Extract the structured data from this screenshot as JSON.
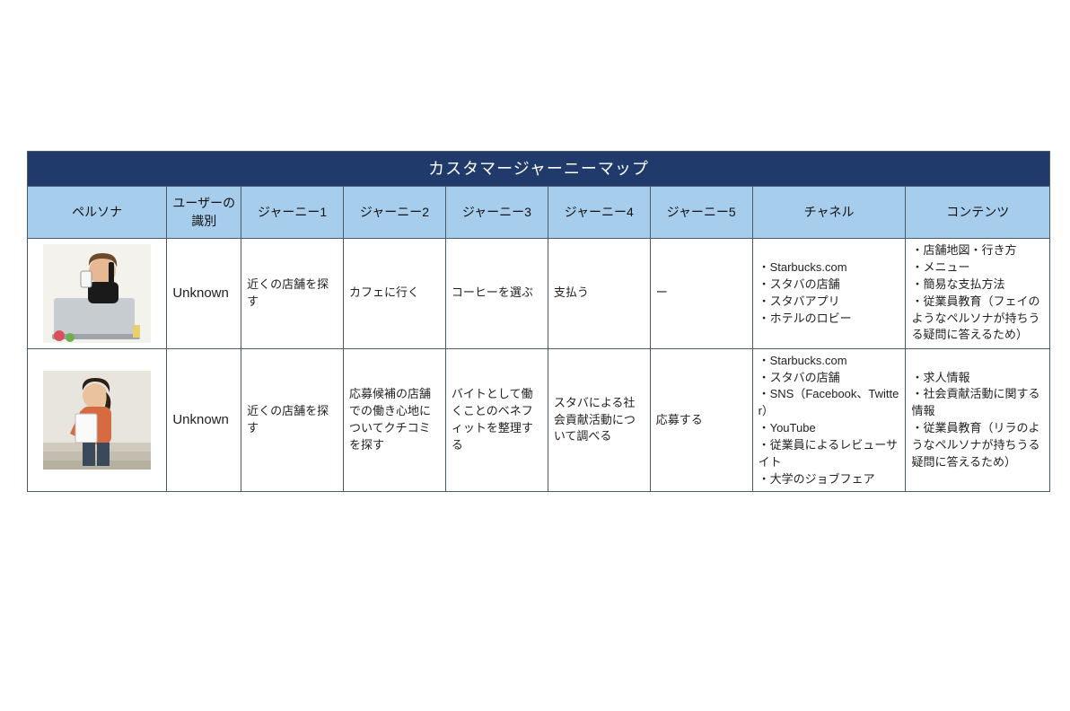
{
  "table": {
    "title": "カスタマージャーニーマップ",
    "headers": [
      "ペルソナ",
      "ユーザーの識別",
      "ジャーニー1",
      "ジャーニー2",
      "ジャーニー3",
      "ジャーニー4",
      "ジャーニー5",
      "チャネル",
      "コンテンツ"
    ],
    "rows": [
      {
        "persona_icon": "persona-woman-phone-laptop",
        "user_identity": "Unknown",
        "journey1": "近くの店舗を探す",
        "journey2": "カフェに行く",
        "journey3": "コーヒーを選ぶ",
        "journey4": "支払う",
        "journey5": "ー",
        "channel": "・Starbucks.com\n・スタバの店舗\n・スタバアプリ\n・ホテルのロビー",
        "contents": "・店舗地図・行き方\n・メニュー\n・簡易な支払方法\n・従業員教育（フェイのようなペルソナが持ちうる疑問に答えるため）"
      },
      {
        "persona_icon": "persona-student-steps",
        "user_identity": "Unknown",
        "journey1": "近くの店舗を探す",
        "journey2": "応募候補の店舗での働き心地についてクチコミを探す",
        "journey3": "バイトとして働くことのベネフィットを整理する",
        "journey4": "スタバによる社会貢献活動について調べる",
        "journey5": "応募する",
        "channel": "・Starbucks.com\n・スタバの店舗\n・SNS（Facebook、Twitter）\n・YouTube\n・従業員によるレビューサイト\n・大学のジョブフェア",
        "contents": "・求人情報\n・社会貢献活動に関する情報\n・従業員教育（リラのようなペルソナが持ちうる疑問に答えるため）"
      }
    ]
  }
}
